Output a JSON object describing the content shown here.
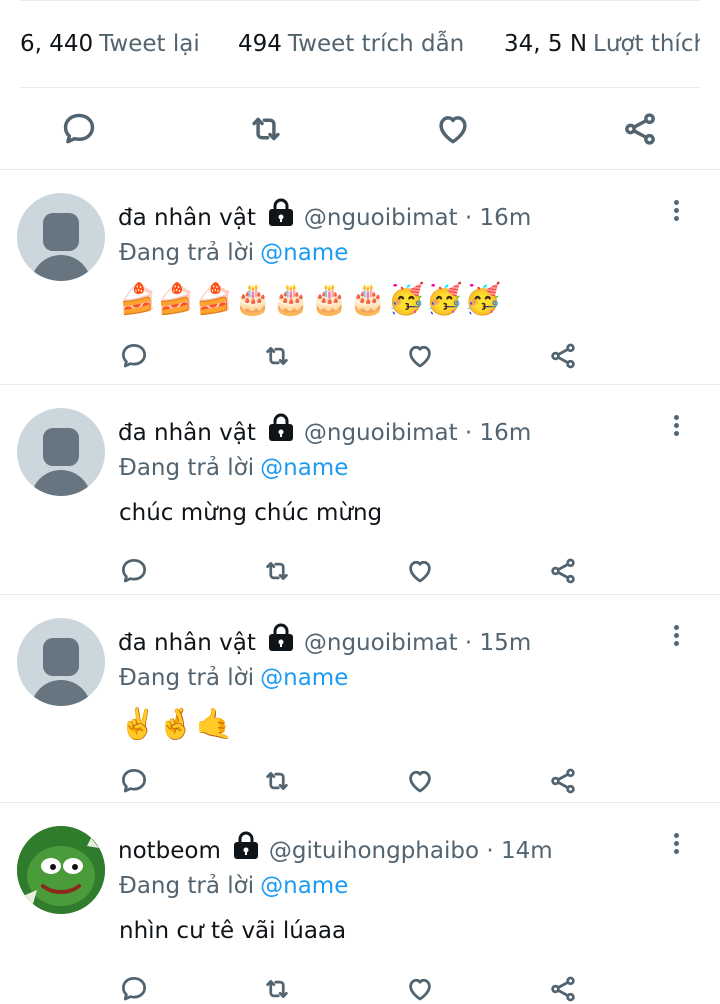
{
  "stats": {
    "retweets_count": "6, 440",
    "retweets_label": "Tweet lại",
    "quotes_count": "494",
    "quotes_label": "Tweet trích dẫn",
    "likes_count": "34, 5 N",
    "likes_label": "Lượt thích"
  },
  "icons": {
    "reply": "reply-icon",
    "retweet": "retweet-icon",
    "like": "heart-icon",
    "share": "share-icon",
    "lock": "lock-icon",
    "more": "more-icon"
  },
  "colors": {
    "text": "#0f1419",
    "secondary": "#536471",
    "link": "#1d9bf0",
    "divider": "#e6ecf0"
  },
  "tweets": [
    {
      "name": "đa nhân vật",
      "handle": "@nguoibimat",
      "dot": "·",
      "time": "16m",
      "reply_label": "Đang trả lời",
      "mention": "@name",
      "text": "🍰🍰🍰🎂🎂🎂🎂🥳🥳🥳"
    },
    {
      "name": "đa nhân vật",
      "handle": "@nguoibimat",
      "dot": "·",
      "time": "16m",
      "reply_label": "Đang trả lời",
      "mention": "@name",
      "text": "chúc mừng chúc mừng"
    },
    {
      "name": "đa nhân vật",
      "handle": "@nguoibimat",
      "dot": "·",
      "time": "15m",
      "reply_label": "Đang trả lời",
      "mention": "@name",
      "text": "✌️🤞🤙"
    },
    {
      "name": "notbeom",
      "handle": "@gituihongphaibo",
      "dot": "·",
      "time": "14m",
      "reply_label": "Đang trả lời",
      "mention": "@name",
      "text": "nhìn cư tê vãi lúaaa"
    }
  ]
}
